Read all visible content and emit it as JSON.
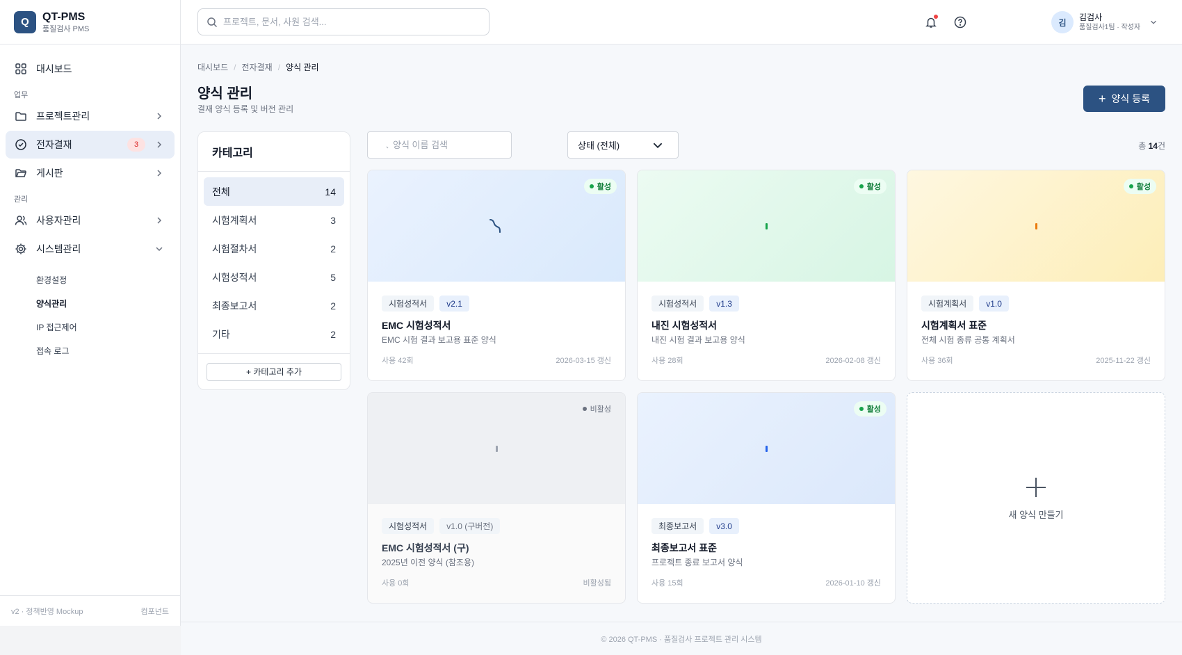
{
  "brand": {
    "logo": "Q",
    "name": "QT-PMS",
    "sub": "품질검사 PMS"
  },
  "search": {
    "placeholder": "프로젝트, 문서, 사원 검색..."
  },
  "nav": {
    "dashboard": "대시보드",
    "group_work": "업무",
    "project": "프로젝트관리",
    "approval": "전자결재",
    "approval_badge": "3",
    "board": "게시판",
    "group_admin": "관리",
    "users": "사용자관리",
    "system": "시스템관리",
    "sub": [
      "환경설정",
      "양식관리",
      "IP 접근제어",
      "접속 로그"
    ]
  },
  "sidebar_footer": {
    "version": "v2 · 정책반영 Mockup",
    "components": "컴포넌트"
  },
  "user": {
    "avatar": "김",
    "name": "김검사",
    "role": "품질검사1팀 · 작성자"
  },
  "breadcrumb": [
    "대시보드",
    "/",
    "전자결재",
    "/",
    "양식 관리"
  ],
  "page": {
    "title": "양식 관리",
    "subtitle": "결재 양식 등록 및 버전 관리",
    "add_button": "양식 등록"
  },
  "categories": {
    "title": "카테고리",
    "items": [
      {
        "label": "전체",
        "count": "14"
      },
      {
        "label": "시험계획서",
        "count": "3"
      },
      {
        "label": "시험절차서",
        "count": "2"
      },
      {
        "label": "시험성적서",
        "count": "5"
      },
      {
        "label": "최종보고서",
        "count": "2"
      },
      {
        "label": "기타",
        "count": "2"
      }
    ],
    "add_button": "+ 카테고리 추가"
  },
  "filters": {
    "search_placeholder": "양식 이름 검색",
    "status_value": "상태 (전체)",
    "total_prefix": "총 ",
    "total_count": "14",
    "total_suffix": "건"
  },
  "cards": [
    {
      "status": "활성",
      "category": "시험성적서",
      "version": "v2.1",
      "name": "EMC 시험성적서",
      "desc": "EMC 시험 결과 보고용 표준 양식",
      "usage": "사용 42회",
      "updated": "2026-03-15 갱신"
    },
    {
      "status": "활성",
      "category": "시험성적서",
      "version": "v1.3",
      "name": "내진 시험성적서",
      "desc": "내진 시험 결과 보고용 양식",
      "usage": "사용 28회",
      "updated": "2026-02-08 갱신"
    },
    {
      "status": "활성",
      "category": "시험계획서",
      "version": "v1.0",
      "name": "시험계획서 표준",
      "desc": "전체 시험 종류 공통 계획서",
      "usage": "사용 36회",
      "updated": "2025-11-22 갱신"
    },
    {
      "status": "비활성",
      "category": "시험성적서",
      "version": "v1.0 (구버전)",
      "name": "EMC 시험성적서 (구)",
      "desc": "2025년 이전 양식 (참조용)",
      "usage": "사용 0회",
      "updated": "비활성됨"
    },
    {
      "status": "활성",
      "category": "최종보고서",
      "version": "v3.0",
      "name": "최종보고서 표준",
      "desc": "프로젝트 종료 보고서 양식",
      "usage": "사용 15회",
      "updated": "2026-01-10 갱신"
    }
  ],
  "new_card": {
    "label": "새 양식 만들기"
  },
  "footer": "© 2026 QT-PMS · 품질검사 프로젝트 관리 시스템",
  "colors": {
    "primary": "#2c5282",
    "active_status": "#16a34a",
    "badge_red": "#dc2626"
  }
}
